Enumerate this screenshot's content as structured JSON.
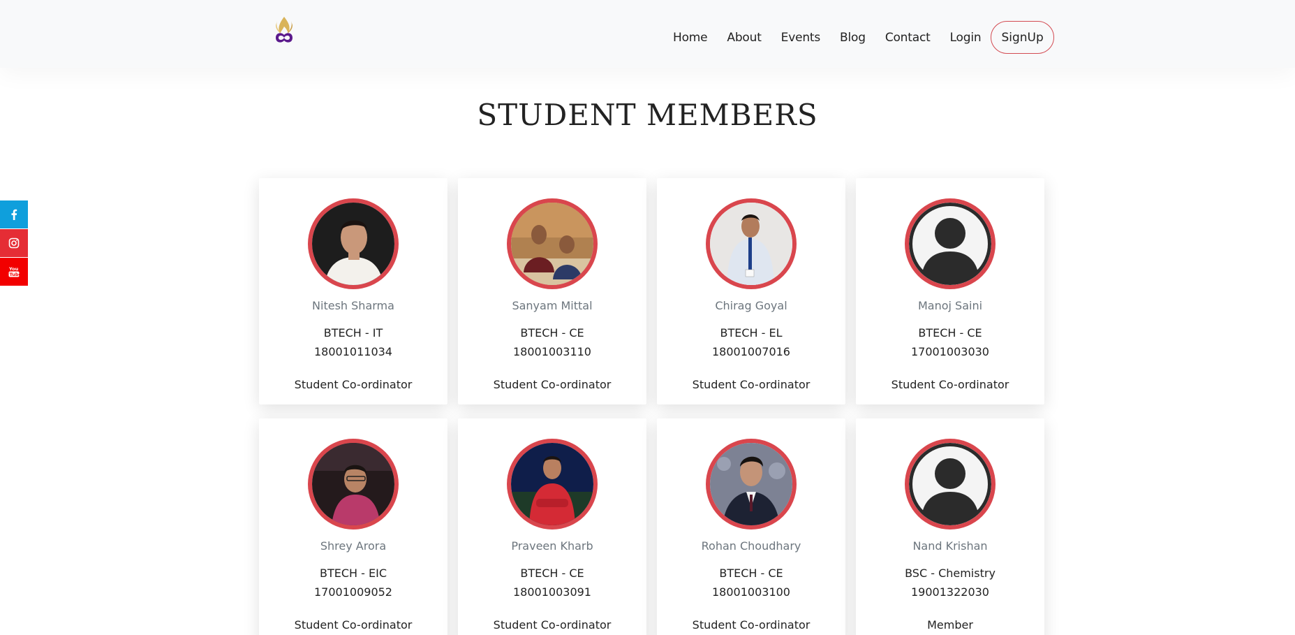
{
  "brand": {
    "logo_icon": "flame-infinity-logo-icon"
  },
  "nav": {
    "items": [
      {
        "label": "Home"
      },
      {
        "label": "About"
      },
      {
        "label": "Events"
      },
      {
        "label": "Blog"
      },
      {
        "label": "Contact"
      },
      {
        "label": "Login"
      }
    ],
    "signup_label": "SignUp",
    "signup_border_color": "#d34b52"
  },
  "social": [
    {
      "icon": "facebook-icon",
      "color": "#0f9fdc"
    },
    {
      "icon": "instagram-icon",
      "color": "#e52d35"
    },
    {
      "icon": "youtube-icon",
      "color": "#f20000"
    }
  ],
  "page": {
    "title": "STUDENT MEMBERS"
  },
  "accent_color": "#d9464d",
  "members": [
    {
      "name": "Nitesh Sharma",
      "course": "BTECH - IT",
      "roll": "18001011034",
      "role": "Student Co-ordinator",
      "photo": "photo"
    },
    {
      "name": "Sanyam Mittal",
      "course": "BTECH - CE",
      "roll": "18001003110",
      "role": "Student Co-ordinator",
      "photo": "photo"
    },
    {
      "name": "Chirag Goyal",
      "course": "BTECH - EL",
      "roll": "18001007016",
      "role": "Student Co-ordinator",
      "photo": "photo"
    },
    {
      "name": "Manoj Saini",
      "course": "BTECH - CE",
      "roll": "17001003030",
      "role": "Student Co-ordinator",
      "photo": "placeholder"
    },
    {
      "name": "Shrey Arora",
      "course": "BTECH - EIC",
      "roll": "17001009052",
      "role": "Student Co-ordinator",
      "photo": "photo"
    },
    {
      "name": "Praveen Kharb",
      "course": "BTECH - CE",
      "roll": "18001003091",
      "role": "Student Co-ordinator",
      "photo": "photo"
    },
    {
      "name": "Rohan Choudhary",
      "course": "BTECH - CE",
      "roll": "18001003100",
      "role": "Student Co-ordinator",
      "photo": "photo"
    },
    {
      "name": "Nand Krishan",
      "course": "BSC - Chemistry",
      "roll": "19001322030",
      "role": "Member",
      "photo": "placeholder"
    }
  ]
}
